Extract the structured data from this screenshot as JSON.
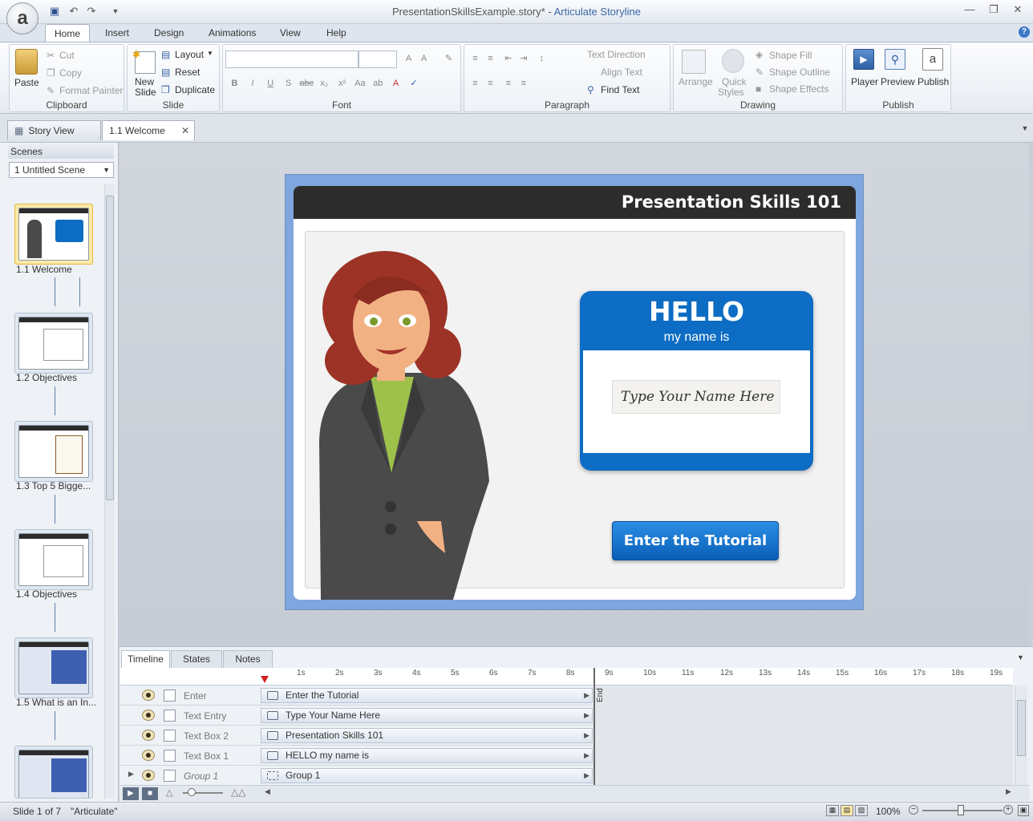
{
  "window": {
    "file_title": "PresentationSkillsExample.story* - ",
    "app_name": "Articulate Storyline",
    "logo_letter": "a"
  },
  "ribbon_tabs": [
    "Home",
    "Insert",
    "Design",
    "Animations",
    "View",
    "Help"
  ],
  "clipboard": {
    "paste": "Paste",
    "cut": "Cut",
    "copy": "Copy",
    "format_painter": "Format Painter",
    "label": "Clipboard"
  },
  "slide_group": {
    "new_slide_1": "New",
    "new_slide_2": "Slide",
    "layout": "Layout",
    "reset": "Reset",
    "duplicate": "Duplicate",
    "label": "Slide"
  },
  "font_group": {
    "label": "Font"
  },
  "paragraph_group": {
    "text_direction": "Text Direction",
    "align_text": "Align Text",
    "find_text": "Find Text",
    "label": "Paragraph"
  },
  "drawing_group": {
    "arrange": "Arrange",
    "quick_styles_1": "Quick",
    "quick_styles_2": "Styles",
    "shape_fill": "Shape Fill",
    "shape_outline": "Shape Outline",
    "shape_effects": "Shape Effects",
    "label": "Drawing"
  },
  "publish_group": {
    "player": "Player",
    "preview": "Preview",
    "publish": "Publish",
    "label": "Publish"
  },
  "doc_tabs": {
    "story_view": "Story View",
    "active_tab": "1.1 Welcome"
  },
  "scenes": {
    "header": "Scenes",
    "selected": "1 Untitled Scene",
    "slides": [
      "1.1 Welcome",
      "1.2 Objectives",
      "1.3 Top 5 Bigge...",
      "1.4 Objectives",
      "1.5 What is an In..."
    ]
  },
  "slide": {
    "title": "Presentation Skills 101",
    "nametag_hello": "HELLO",
    "nametag_sub": "my name is",
    "name_input_placeholder": "Type Your Name Here",
    "button": "Enter the Tutorial"
  },
  "timeline": {
    "tabs": [
      "Timeline",
      "States",
      "Notes"
    ],
    "ticks": [
      "1s",
      "2s",
      "3s",
      "4s",
      "5s",
      "6s",
      "7s",
      "8s",
      "9s",
      "10s",
      "11s",
      "12s",
      "13s",
      "14s",
      "15s",
      "16s",
      "17s",
      "18s",
      "19s"
    ],
    "end_label": "End",
    "rows": [
      {
        "name": "Enter",
        "bar": "Enter the Tutorial"
      },
      {
        "name": "Text Entry",
        "bar": "Type Your Name Here"
      },
      {
        "name": "Text Box 2",
        "bar": "Presentation Skills 101"
      },
      {
        "name": "Text Box 1",
        "bar": "HELLO my name is"
      },
      {
        "name": "Group 1",
        "bar": "Group 1"
      }
    ]
  },
  "status": {
    "slide_of": "Slide 1 of 7",
    "theme": "\"Articulate\"",
    "zoom": "100%"
  }
}
